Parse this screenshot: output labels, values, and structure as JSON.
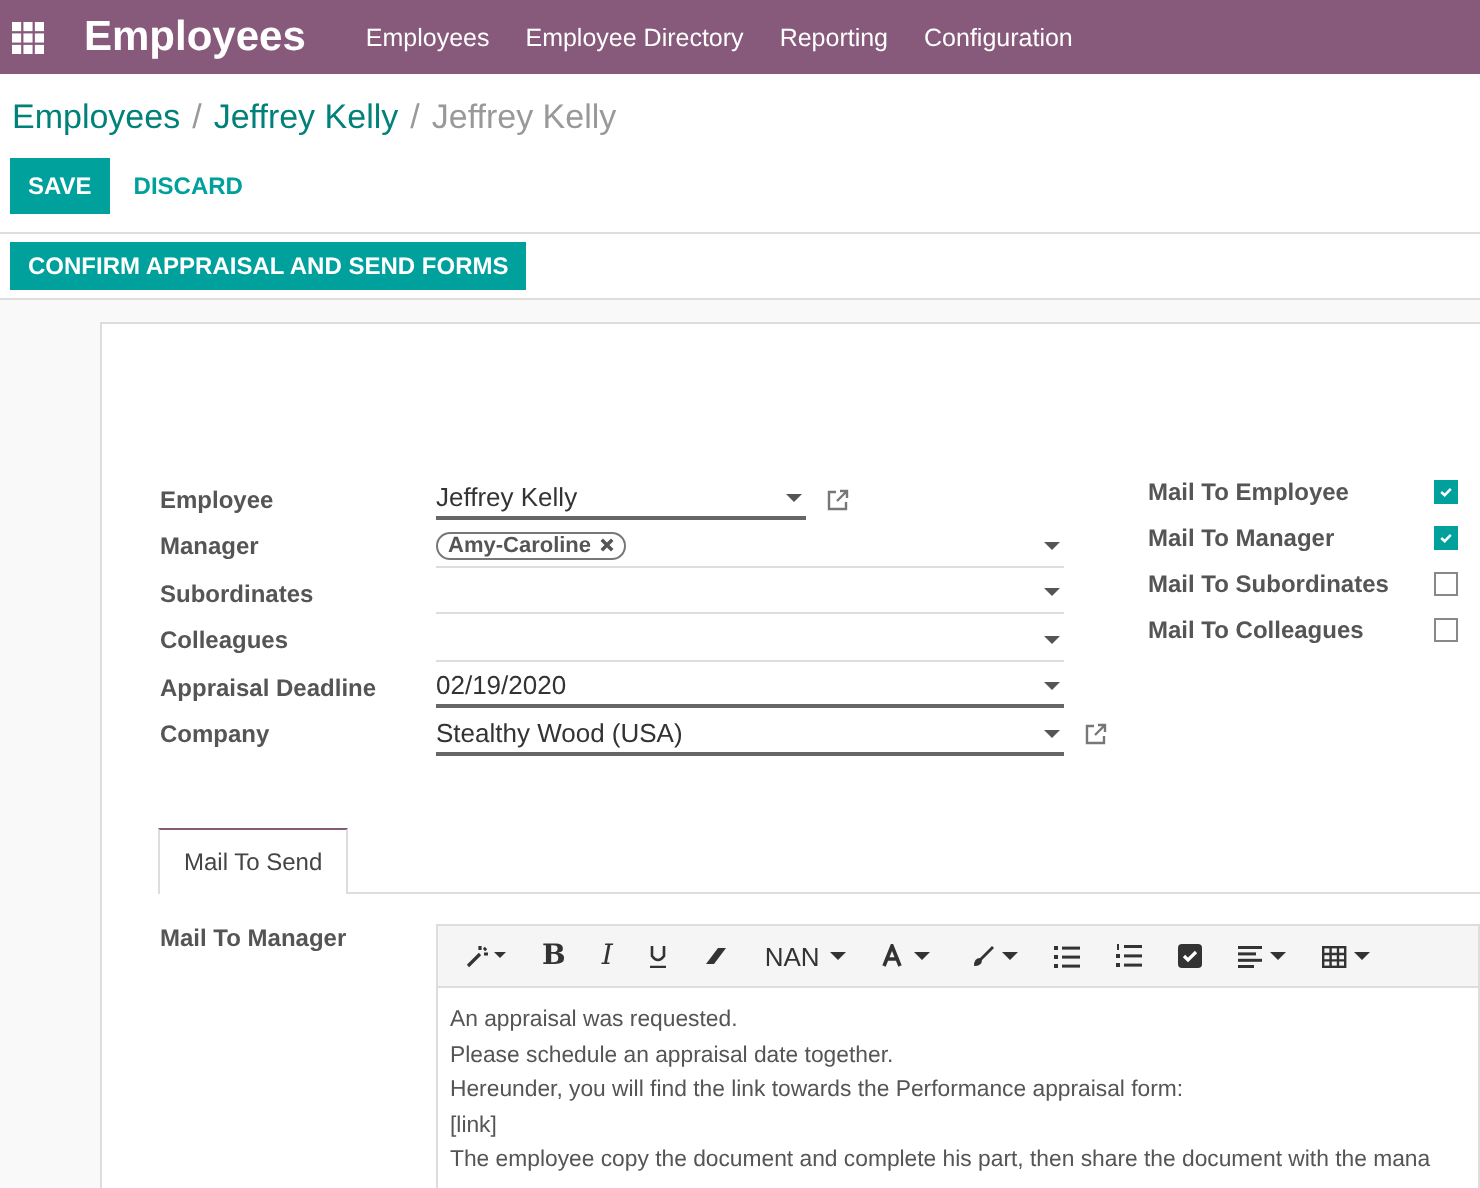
{
  "app": {
    "title": "Employees"
  },
  "menu": [
    "Employees",
    "Employee Directory",
    "Reporting",
    "Configuration"
  ],
  "breadcrumb_separator": "/",
  "breadcrumb": [
    {
      "label": "Employees",
      "link": true
    },
    {
      "label": "Jeffrey Kelly",
      "link": true
    },
    {
      "label": "Jeffrey Kelly",
      "link": false
    }
  ],
  "actions": {
    "save": "SAVE",
    "discard": "DISCARD"
  },
  "header_button": "CONFIRM APPRAISAL AND SEND FORMS",
  "fields": [
    {
      "label": "Employee",
      "value": "Jeffrey Kelly",
      "required": true,
      "external_link": true
    },
    {
      "label": "Manager",
      "tags": [
        "Amy-Caroline"
      ],
      "required": false,
      "external_link": false
    },
    {
      "label": "Subordinates",
      "required": false,
      "external_link": false
    },
    {
      "label": "Colleagues",
      "required": false,
      "external_link": false
    },
    {
      "label": "Appraisal Deadline",
      "value": "02/19/2020",
      "required": true,
      "external_link": false
    },
    {
      "label": "Company",
      "value": "Stealthy Wood (USA)",
      "required": true,
      "external_link": true
    }
  ],
  "mail_options": [
    {
      "label": "Mail To Employee",
      "checked": true
    },
    {
      "label": "Mail To Manager",
      "checked": true
    },
    {
      "label": "Mail To Subordinates",
      "checked": false
    },
    {
      "label": "Mail To Colleagues",
      "checked": false
    }
  ],
  "tabs": [
    {
      "label": "Mail To Send",
      "selected": true
    }
  ],
  "mail": {
    "label": "Mail To Manager",
    "font_size_menu": "NAN",
    "bold_button": "B",
    "italic_button": "I",
    "body": [
      "An appraisal was requested.",
      "Please schedule an appraisal date together.",
      "Hereunder, you will find the link towards the Performance appraisal form:",
      "[link]",
      "The employee copy the document and complete his part, then share the document with the mana"
    ]
  }
}
